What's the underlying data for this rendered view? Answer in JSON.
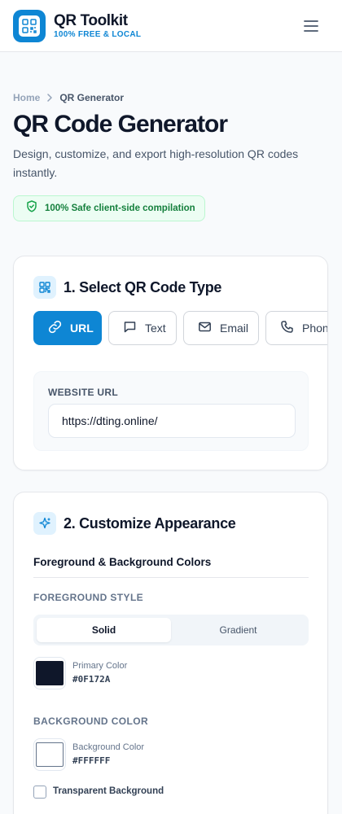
{
  "header": {
    "brand_name": "QR Toolkit",
    "brand_tagline": "100% FREE & LOCAL",
    "logo_icon": "qr-code-icon",
    "menu_icon": "hamburger-menu-icon"
  },
  "breadcrumb": {
    "home": "Home",
    "current": "QR Generator",
    "separator_icon": "chevron-right-icon"
  },
  "page": {
    "title": "QR Code Generator",
    "subtitle": "Design, customize, and export high-resolution QR codes instantly.",
    "safe_badge": "100% Safe client-side compilation",
    "safe_icon": "shield-check-icon"
  },
  "step1": {
    "title": "1. Select QR Code Type",
    "icon": "qr-scan-icon",
    "types": [
      {
        "label": "URL",
        "icon": "link-icon",
        "active": true
      },
      {
        "label": "Text",
        "icon": "message-icon",
        "active": false
      },
      {
        "label": "Email",
        "icon": "mail-icon",
        "active": false
      },
      {
        "label": "Phone",
        "icon": "phone-icon",
        "active": false
      }
    ],
    "url_field_label": "WEBSITE URL",
    "url_value": "https://dting.online/"
  },
  "step2": {
    "title": "2. Customize Appearance",
    "icon": "sparkle-icon",
    "section_heading": "Foreground & Background Colors",
    "foreground_label": "FOREGROUND STYLE",
    "style_options": [
      "Solid",
      "Gradient"
    ],
    "selected_style": "Solid",
    "primary_color_name": "Primary Color",
    "primary_color_hex": "#0F172A",
    "background_label": "BACKGROUND COLOR",
    "background_color_name": "Background Color",
    "background_color_hex": "#FFFFFF",
    "transparent_label": "Transparent Background",
    "transparent_checked": false
  },
  "colors": {
    "accent": "#0E86D4",
    "success": "#15803D",
    "text_dark": "#0F172A"
  }
}
